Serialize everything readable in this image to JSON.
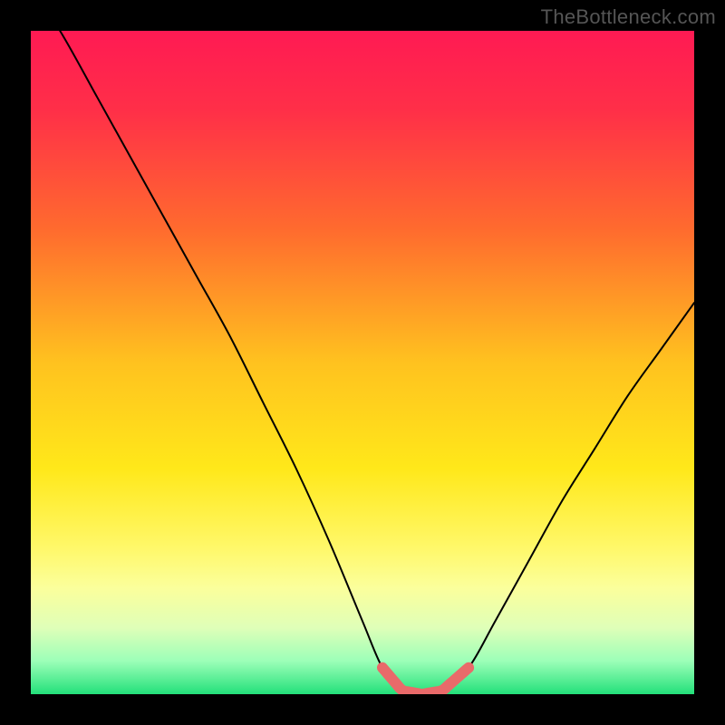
{
  "watermark": "TheBottleneck.com",
  "colors": {
    "background": "#000000",
    "gradient_stops": [
      {
        "offset": 0.0,
        "color": "#ff1a53"
      },
      {
        "offset": 0.12,
        "color": "#ff2f48"
      },
      {
        "offset": 0.3,
        "color": "#ff6b2e"
      },
      {
        "offset": 0.5,
        "color": "#ffc21f"
      },
      {
        "offset": 0.66,
        "color": "#ffe81a"
      },
      {
        "offset": 0.78,
        "color": "#fff86a"
      },
      {
        "offset": 0.84,
        "color": "#fbff9c"
      },
      {
        "offset": 0.9,
        "color": "#dfffb8"
      },
      {
        "offset": 0.95,
        "color": "#9cffb8"
      },
      {
        "offset": 1.0,
        "color": "#23e07a"
      }
    ],
    "curve_stroke": "#000000",
    "highlight_stroke": "#e96a6a"
  },
  "chart_data": {
    "type": "line",
    "title": "",
    "xlabel": "",
    "ylabel": "",
    "xlim": [
      0,
      1
    ],
    "ylim": [
      0,
      1
    ],
    "series": [
      {
        "name": "bottleneck-curve",
        "x": [
          0.0,
          0.05,
          0.1,
          0.15,
          0.2,
          0.25,
          0.3,
          0.35,
          0.4,
          0.45,
          0.5,
          0.53,
          0.56,
          0.59,
          0.62,
          0.66,
          0.7,
          0.75,
          0.8,
          0.85,
          0.9,
          0.95,
          1.0
        ],
        "values": [
          1.07,
          0.99,
          0.9,
          0.81,
          0.72,
          0.63,
          0.54,
          0.44,
          0.34,
          0.23,
          0.11,
          0.04,
          0.005,
          0.0,
          0.005,
          0.04,
          0.11,
          0.2,
          0.29,
          0.37,
          0.45,
          0.52,
          0.59
        ]
      }
    ],
    "highlight_range_x": [
      0.53,
      0.66
    ],
    "curve_stroke_width": 2,
    "highlight_stroke_width": 12
  }
}
